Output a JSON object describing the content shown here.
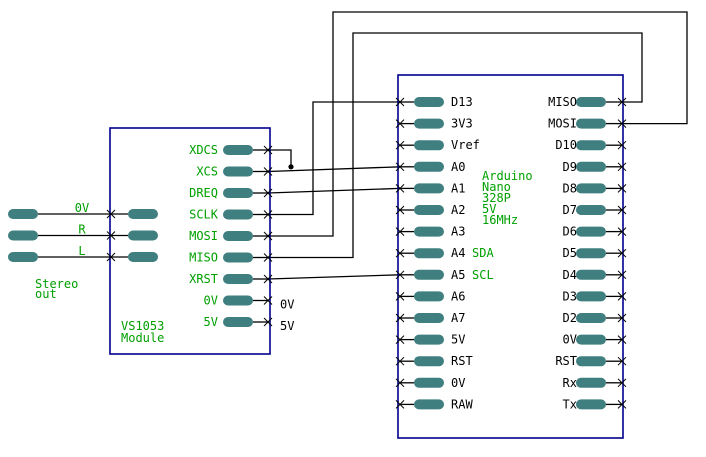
{
  "colors": {
    "wire": "#000000",
    "body": "#000090",
    "pad": "#3f7f7f",
    "label": "#000000",
    "note": "#00a000"
  },
  "stereo": {
    "pins": [
      "0V",
      "R",
      "L"
    ],
    "caption_lines": [
      "Stereo",
      "out"
    ]
  },
  "vs1053": {
    "pins": [
      "XDCS",
      "XCS",
      "DREQ",
      "SCLK",
      "MOSI",
      "MISO",
      "XRST",
      "0V",
      "5V"
    ],
    "outside_labels": [
      "0V",
      "5V"
    ],
    "caption_lines": [
      "VS1053",
      "Module"
    ]
  },
  "arduino": {
    "left_pins": [
      "D13",
      "3V3",
      "Vref",
      "A0",
      "A1",
      "A2",
      "A3",
      "A4",
      "A5",
      "A6",
      "A7",
      "5V",
      "RST",
      "0V",
      "RAW"
    ],
    "right_pins": [
      "MISO",
      "MOSI",
      "D10",
      "D9",
      "D8",
      "D7",
      "D6",
      "D5",
      "D4",
      "D3",
      "D2",
      "0V",
      "RST",
      "Rx",
      "Tx"
    ],
    "inline_notes": {
      "A4": "SDA",
      "A5": "SCL"
    },
    "caption_lines": [
      "Arduino",
      "Nano",
      "328P",
      "5V",
      "16MHz"
    ]
  }
}
